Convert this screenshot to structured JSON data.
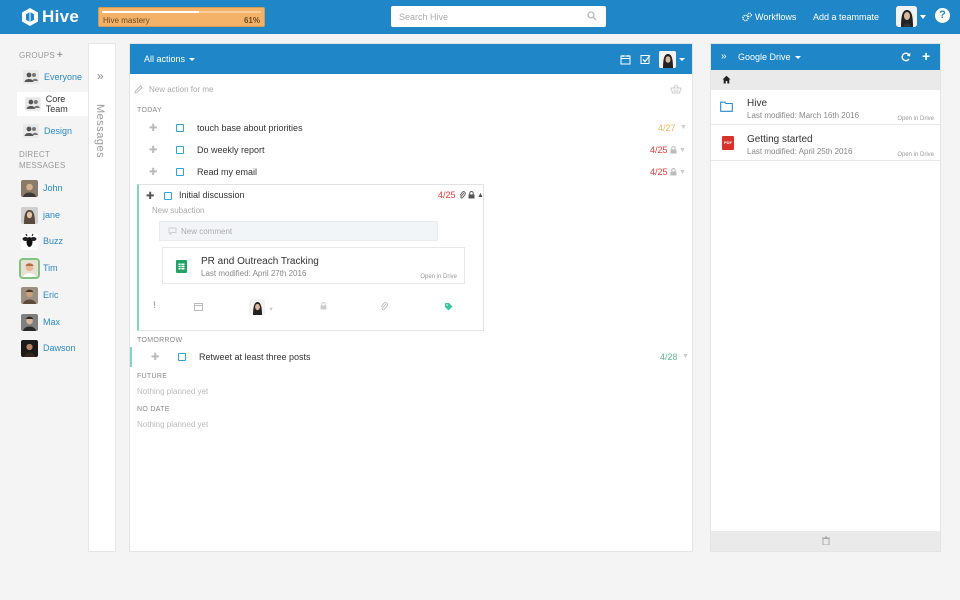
{
  "app": {
    "name": "Hive",
    "brand_color": "#1f86c7",
    "mastery": {
      "label": "Hive mastery",
      "percent_text": "61%",
      "progress": 0.61
    },
    "search": {
      "placeholder": "Search Hive"
    },
    "nav": {
      "workflows": "Workflows",
      "add_teammate": "Add a teammate",
      "help": "?"
    }
  },
  "sidebar": {
    "groups_title": "GROUPS",
    "groups": [
      {
        "label": "Everyone"
      },
      {
        "label": "Core Team"
      },
      {
        "label": "Design"
      }
    ],
    "dm_title_line1": "DIRECT",
    "dm_title_line2": "MESSAGES",
    "direct_messages": [
      {
        "label": "John"
      },
      {
        "label": "jane"
      },
      {
        "label": "Buzz"
      },
      {
        "label": "Tim"
      },
      {
        "label": "Eric"
      },
      {
        "label": "Max"
      },
      {
        "label": "Dawson"
      }
    ],
    "messages_rail": "Messages"
  },
  "main": {
    "filter_label": "All actions",
    "new_action_placeholder": "New action for me",
    "sections": {
      "today": "TODAY",
      "tomorrow": "TOMORROW",
      "future": "FUTURE",
      "no_date": "NO DATE"
    },
    "empty_note": "Nothing planned yet",
    "today_actions": [
      {
        "title": "touch base about priorities",
        "date": "4/27",
        "date_color": "#f4b55c"
      },
      {
        "title": "Do weekly report",
        "date": "4/25",
        "date_color": "#e53935"
      },
      {
        "title": "Read my email",
        "date": "4/25",
        "date_color": "#e53935"
      }
    ],
    "expanded_action": {
      "title": "Initial discussion",
      "date": "4/25",
      "subaction_placeholder": "New subaction",
      "comment_placeholder": "New comment",
      "attachment": {
        "name": "PR and Outreach Tracking",
        "modified": "Last modified: April 27th 2016",
        "open_label": "Open in Drive"
      }
    },
    "tomorrow_actions": [
      {
        "title": "Retweet at least three posts",
        "date": "4/28",
        "date_color": "#5bbf8f"
      }
    ]
  },
  "drive": {
    "title": "Google Drive",
    "files": [
      {
        "name": "Hive",
        "modified": "Last modified: March 16th 2016",
        "open_label": "Open in Drive",
        "icon": "folder-icon"
      },
      {
        "name": "Getting started",
        "modified": "Last modified: April 25th 2016",
        "open_label": "Open in Drive",
        "icon": "pdf-icon",
        "icon_text": "PDF"
      }
    ]
  }
}
